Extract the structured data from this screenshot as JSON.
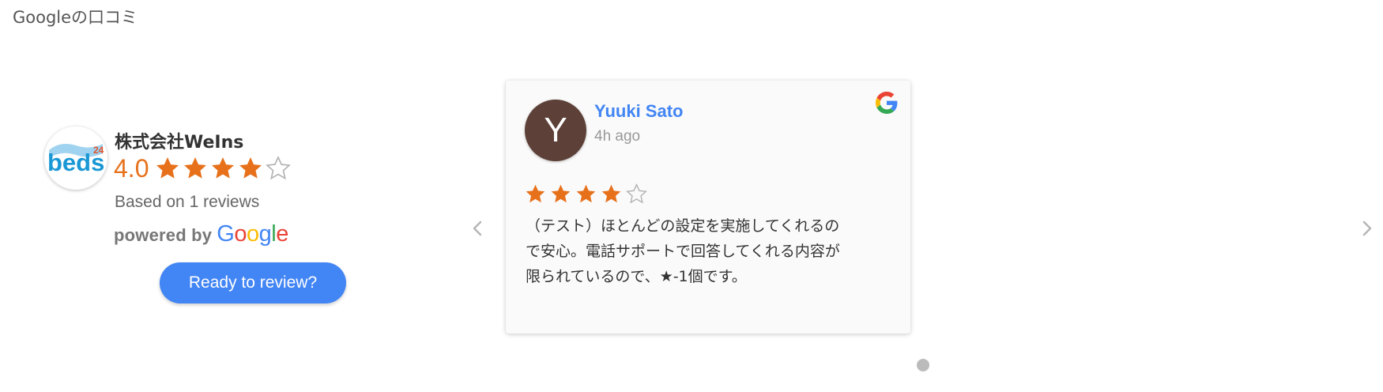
{
  "section": {
    "title": "Googleの口コミ"
  },
  "summary": {
    "logo_icon": "beds24-logo",
    "business_name": "株式会社WeIns",
    "rating": "4.0",
    "rating_value": 4,
    "rating_max": 5,
    "based_on": "Based on 1 reviews",
    "powered_by": "powered by",
    "google_letters": [
      "G",
      "o",
      "o",
      "g",
      "l",
      "e"
    ],
    "review_button_label": "Ready to review?"
  },
  "carousel": {
    "prev_icon": "chevron-left-icon",
    "next_icon": "chevron-right-icon",
    "pages": 1,
    "current_page": 1
  },
  "review": {
    "avatar_initial": "Y",
    "reviewer_name": "Yuuki Sato",
    "time_ago": "4h ago",
    "source_icon": "google-g-icon",
    "rating": 4,
    "rating_max": 5,
    "text_lines": [
      "（テスト）ほとんどの設定を実施してくれるの",
      "で安心。電話サポートで回答してくれる内容が",
      "限られているので、★-1個です。"
    ]
  },
  "colors": {
    "star_filled": "#e7711b",
    "star_empty": "#b0b0b0",
    "accent_blue": "#4285f4",
    "avatar_bg": "#5d4037",
    "google_blue": "#4285F4",
    "google_red": "#EA4335",
    "google_yellow": "#FBBC05",
    "google_green": "#34A853"
  }
}
